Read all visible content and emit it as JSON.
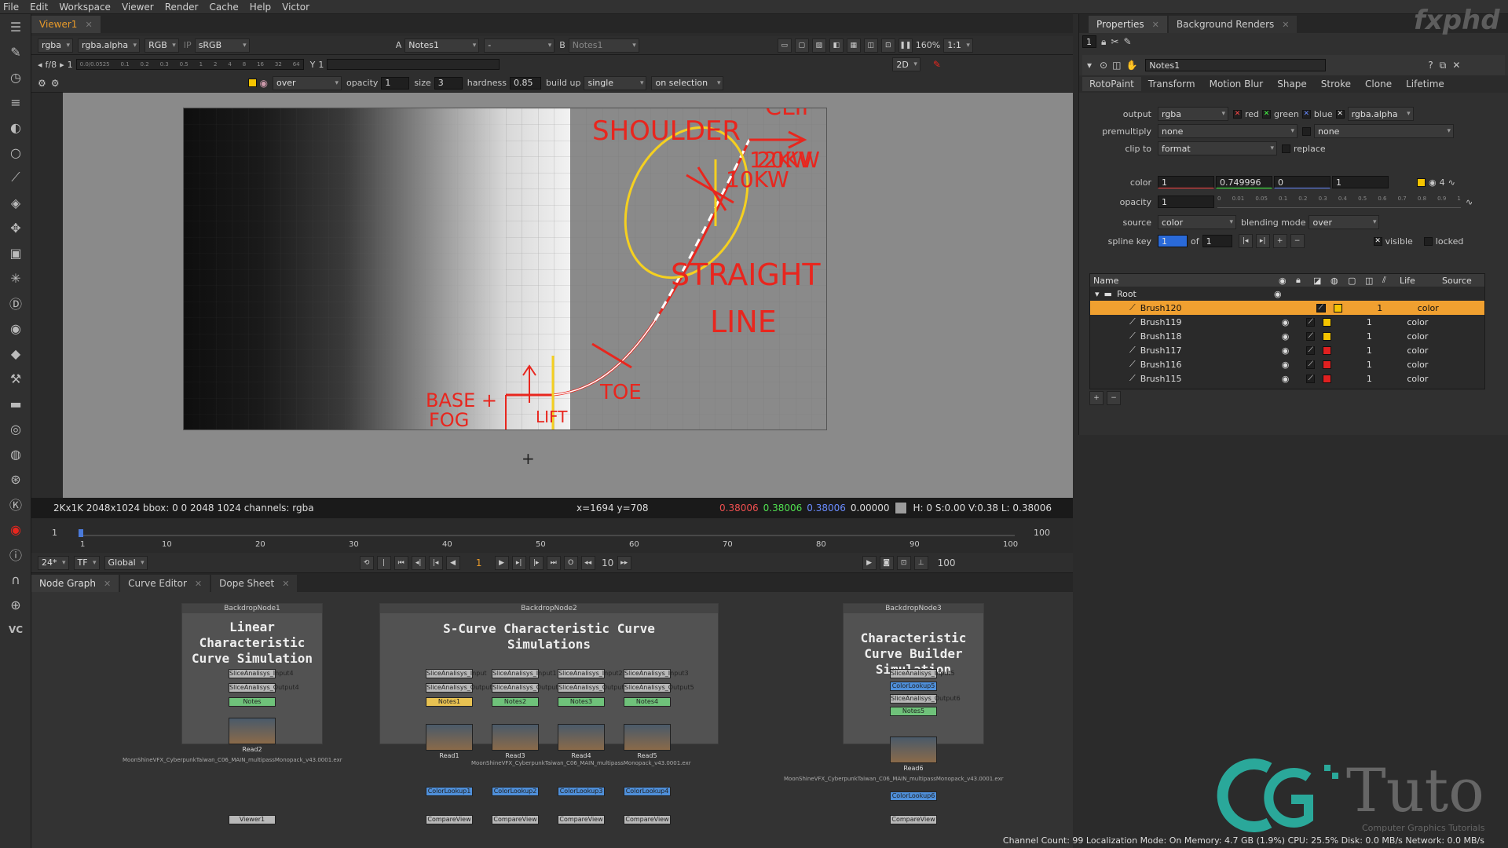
{
  "menu": [
    "File",
    "Edit",
    "Workspace",
    "Viewer",
    "Render",
    "Cache",
    "Help",
    "Victor"
  ],
  "viewer_tab": {
    "label": "Viewer1",
    "close": "✕"
  },
  "viewer_controls": {
    "channels": "rgba",
    "alpha": "rgba.alpha",
    "colorspace_in": "RGB",
    "ip": "IP",
    "lut": "sRGB",
    "a_label": "A",
    "a_input": "Notes1",
    "a_op": "-",
    "b_label": "B",
    "b_input": "Notes1",
    "zoom": "160%",
    "ratio": "1:1",
    "fstop": "f/8",
    "frame": "1",
    "y_label": "Y",
    "y_value": "1",
    "view_mode": "2D",
    "ruler": [
      "0.0/0.0525",
      "0.05",
      "0.1",
      "0.2",
      "0.3",
      "0.5",
      "1",
      "2",
      "4",
      "8",
      "16",
      "32",
      "64"
    ]
  },
  "paint_bar": {
    "blend": "over",
    "opacity_label": "opacity",
    "opacity": "1",
    "size_label": "size",
    "size": "3",
    "hardness_label": "hardness",
    "hardness": "0.85",
    "buildup_label": "build up",
    "mode": "single",
    "selection": "on selection"
  },
  "annotations": {
    "clip": "CLIP",
    "shoulder": "SHOULDER",
    "k12": "12KW",
    "k20": "20KW",
    "k10": "10KW",
    "straight": "STRAIGHT",
    "line": "LINE",
    "toe": "TOE",
    "base": "BASE +",
    "fog": "FOG",
    "lift": "LIFT"
  },
  "info_bar": {
    "format": "2Kx1K 2048x1024  bbox: 0 0 2048 1024 channels: rgba",
    "coords": "x=1694 y=708",
    "r": "0.38006",
    "g": "0.38006",
    "b": "0.38006",
    "a": "0.00000",
    "hsv": "H:  0 S:0.00 V:0.38  L: 0.38006"
  },
  "timeline": {
    "start": "1",
    "end": "100",
    "ticks": [
      "1",
      "10",
      "20",
      "30",
      "40",
      "50",
      "60",
      "70",
      "80",
      "90",
      "100"
    ]
  },
  "transport": {
    "fps": "24*",
    "tf": "TF",
    "global": "Global",
    "frame": "1",
    "step": "10",
    "end": "100"
  },
  "bottom_tabs": [
    {
      "label": "Node Graph"
    },
    {
      "label": "Curve Editor"
    },
    {
      "label": "Dope Sheet"
    }
  ],
  "backdrops": [
    {
      "header": "BackdropNode1",
      "title": "Linear Characteristic Curve Simulation"
    },
    {
      "header": "BackdropNode2",
      "title": "S-Curve Characteristic Curve Simulations"
    },
    {
      "header": "BackdropNode3",
      "title": "Characteristic Curve Builder Simulation"
    }
  ],
  "nodes": {
    "bd1": {
      "in": "SliceAnalisys_Input4",
      "out": "SliceAnalisys_Output4",
      "notes": "Notes",
      "read": "Read2",
      "path": "MoonShineVFX_CyberpunkTaiwan_C06_MAIN_multipassMonopack_v43.0001.exr",
      "viewer": "Viewer1"
    },
    "bd2": [
      {
        "in": "SliceAnalisys_Input",
        "out": "SliceAnalisys_Output",
        "notes": "Notes1",
        "read": "Read1",
        "cl": "ColorLookup1",
        "cv": "CompareView"
      },
      {
        "in": "SliceAnalisys_Input1",
        "out": "SliceAnalisys_Output3",
        "notes": "Notes2",
        "read": "Read3",
        "cl": "ColorLookup2",
        "cv": "CompareView"
      },
      {
        "in": "SliceAnalisys_Input2",
        "out": "SliceAnalisys_Output4",
        "notes": "Notes3",
        "read": "Read4",
        "cl": "ColorLookup3",
        "cv": "CompareView"
      },
      {
        "in": "SliceAnalisys_Input3",
        "out": "SliceAnalisys_Output5",
        "notes": "Notes4",
        "read": "Read5",
        "cl": "ColorLookup4",
        "cv": "CompareView"
      }
    ],
    "bd2_path": "MoonShineVFX_CyberpunkTaiwan_C06_MAIN_multipassMonopack_v43.0001.exr",
    "bd3": {
      "in": "SliceAnalisys_Input5",
      "cl_top": "ColorLookup5",
      "out": "SliceAnalisys_Output6",
      "notes": "Notes5",
      "read": "Read6",
      "cl": "ColorLookup6",
      "cv": "CompareView",
      "path": "MoonShineVFX_CyberpunkTaiwan_C06_MAIN_multipassMonopack_v43.0001.exr"
    }
  },
  "props_tabs": [
    {
      "label": "Properties"
    },
    {
      "label": "Background Renders"
    }
  ],
  "props": {
    "count": "1",
    "node_name": "Notes1",
    "tabs": [
      "RotoPaint",
      "Transform",
      "Motion Blur",
      "Shape",
      "Stroke",
      "Clone",
      "Lifetime"
    ],
    "output_label": "output",
    "output": "rgba",
    "red": "red",
    "green": "green",
    "blue": "blue",
    "alpha": "rgba.alpha",
    "premult_label": "premultiply",
    "premult": "none",
    "premult2": "none",
    "clip_label": "clip to",
    "clip": "format",
    "replace": "replace",
    "color_label": "color",
    "color": [
      "1",
      "0.749996",
      "0",
      "1"
    ],
    "color_count": "4",
    "opacity_label": "opacity",
    "opacity": "1",
    "source_label": "source",
    "source": "color",
    "blend_label": "blending mode",
    "blend": "over",
    "spline_label": "spline key",
    "spline": "1",
    "of": "of",
    "of_val": "1",
    "visible": "visible",
    "locked": "locked",
    "opacity_ticks": [
      "0",
      "0.01",
      "0.05",
      "0.1",
      "0.2",
      "0.3",
      "0.4",
      "0.5",
      "0.6",
      "0.7",
      "0.8",
      "0.9",
      "1"
    ]
  },
  "layers": {
    "header": {
      "name": "Name",
      "life": "Life",
      "source": "Source"
    },
    "root": "Root",
    "rows": [
      {
        "name": "Brush120",
        "life": "1",
        "source": "color",
        "color": "#f5c400"
      },
      {
        "name": "Brush119",
        "life": "1",
        "source": "color",
        "color": "#f5c400"
      },
      {
        "name": "Brush118",
        "life": "1",
        "source": "color",
        "color": "#f5c400"
      },
      {
        "name": "Brush117",
        "life": "1",
        "source": "color",
        "color": "#e02020"
      },
      {
        "name": "Brush116",
        "life": "1",
        "source": "color",
        "color": "#e02020"
      },
      {
        "name": "Brush115",
        "life": "1",
        "source": "color",
        "color": "#e02020"
      }
    ],
    "add": "+",
    "remove": "−"
  },
  "status": "Channel Count: 99  Localization Mode: On  Memory: 4.7 GB (1.9%)  CPU: 25.5%  Disk: 0.0 MB/s  Network: 0.0 MB/s",
  "brand": {
    "fxphd": "fxphd",
    "tuto": "Tuto",
    "sub": "Computer Graphics Tutorials"
  },
  "colors": {
    "accent": "#e89a2a",
    "annot_red": "#e8261e",
    "annot_yellow": "#f5d020",
    "selected_row": "#f0a030"
  }
}
